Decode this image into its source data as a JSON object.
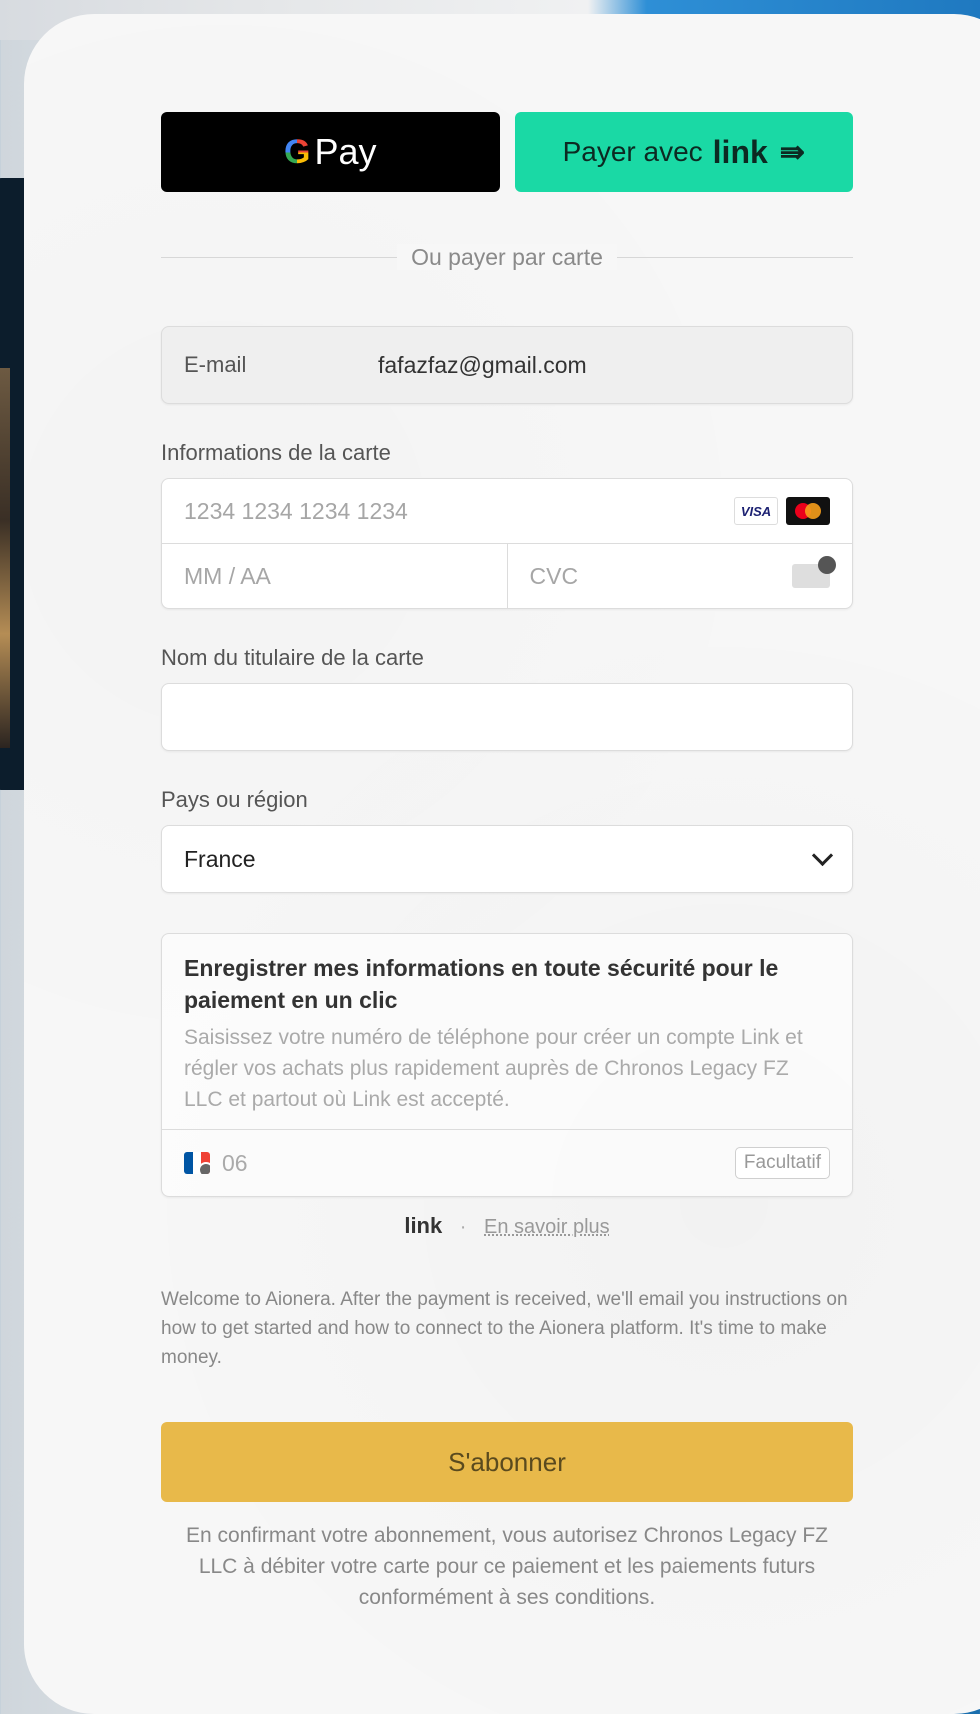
{
  "pay_buttons": {
    "gpay_g": "G",
    "gpay_label": "Pay",
    "link_prefix": "Payer avec",
    "link_brand": "link",
    "link_arrow": "⇛"
  },
  "divider_text": "Ou payer par carte",
  "email": {
    "label": "E-mail",
    "value": "fafazfaz@gmail.com"
  },
  "card": {
    "section_label": "Informations de la carte",
    "number_placeholder": "1234 1234 1234 1234",
    "visa_label": "VISA",
    "expiry_placeholder": "MM / AA",
    "cvc_placeholder": "CVC",
    "icons": [
      "visa-icon",
      "mastercard-icon",
      "cvc-card-icon"
    ]
  },
  "cardholder": {
    "label": "Nom du titulaire de la carte",
    "value": ""
  },
  "country": {
    "label": "Pays ou région",
    "selected": "France"
  },
  "save_info": {
    "title": "Enregistrer mes informations en toute sécurité pour le paiement en un clic",
    "description": "Saisissez votre numéro de téléphone pour créer un compte Link et régler vos achats plus rapidement auprès de Chronos Legacy FZ LLC et partout où Link est accepté.",
    "phone_value": "06",
    "optional_badge": "Facultatif"
  },
  "link_footer": {
    "brand": "link",
    "separator": "·",
    "learn_more": "En savoir plus"
  },
  "welcome_text": "Welcome to Aionera. After the payment is received, we'll email you instructions on how to get started and how to connect to the Aionera platform. It's time to make money.",
  "subscribe_label": "S'abonner",
  "legal_text": "En confirmant votre abonnement, vous autorisez Chronos Legacy FZ LLC à débiter votre carte pour ce paiement et les paiements futurs conformément à ses conditions.",
  "colors": {
    "link_green": "#1ad9a5",
    "subscribe_yellow": "#e8b94a",
    "gpay_black": "#000000"
  }
}
